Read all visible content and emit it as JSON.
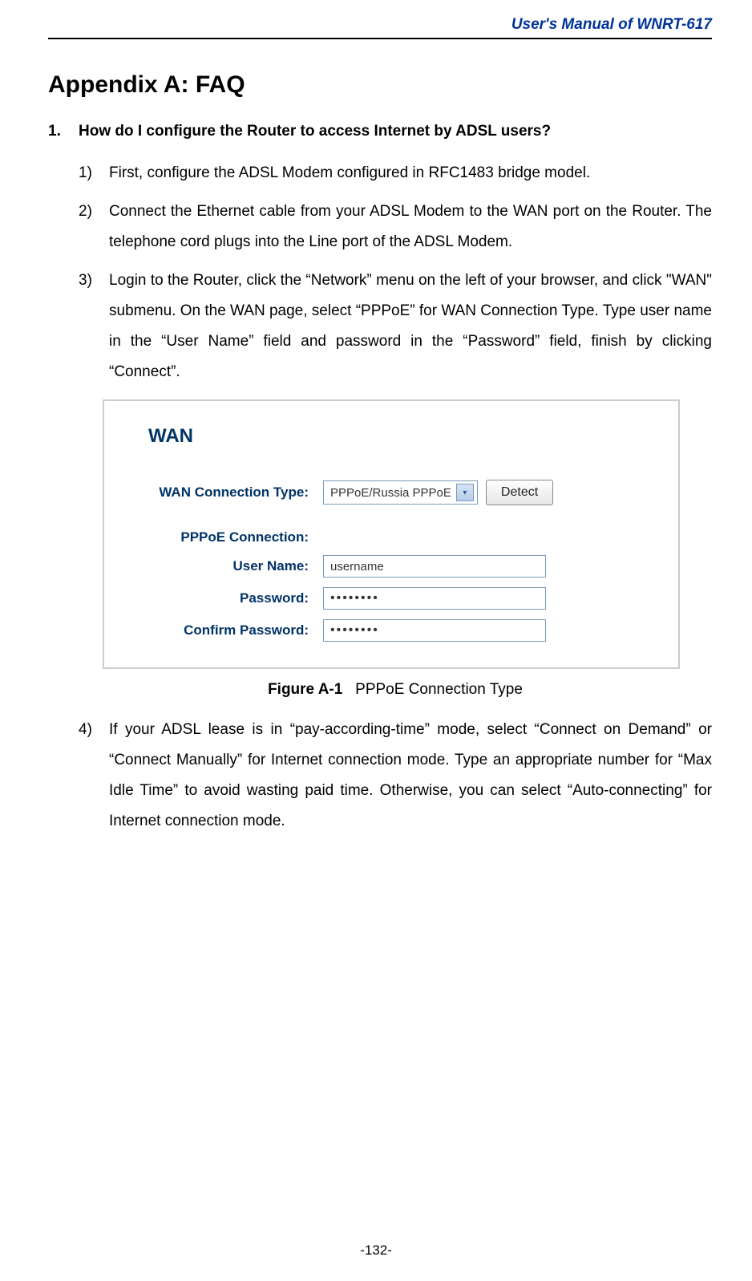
{
  "header": "User's Manual of WNRT-617",
  "h1": "Appendix A: FAQ",
  "question": {
    "num": "1.",
    "text": "How do I configure the Router to access Internet by ADSL users?"
  },
  "steps": [
    {
      "num": "1)",
      "text": "First, configure the ADSL Modem configured in RFC1483 bridge model."
    },
    {
      "num": "2)",
      "text": "Connect the Ethernet cable from your ADSL Modem to the WAN port on the Router. The telephone cord plugs into the Line port of the ADSL Modem."
    },
    {
      "num": "3)",
      "text": "Login to the Router, click the “Network” menu on the left of your browser, and click \"WAN\" submenu. On the WAN page, select “PPPoE” for WAN Connection Type. Type user name in the “User Name” field and password in the “Password” field, finish by clicking “Connect”."
    },
    {
      "num": "4)",
      "text": "If your ADSL lease is in “pay-according-time” mode, select “Connect on Demand” or “Connect Manually” for Internet connection mode. Type an appropriate number for “Max Idle Time” to avoid wasting paid time. Otherwise, you can select “Auto-connecting” for Internet connection mode."
    }
  ],
  "figure": {
    "heading": "WAN",
    "labels": {
      "wan_conn": "WAN Connection Type:",
      "pppoe_conn": "PPPoE Connection:",
      "username": "User Name:",
      "password": "Password:",
      "confirm": "Confirm Password:"
    },
    "values": {
      "wan_select": "PPPoE/Russia PPPoE",
      "detect_btn": "Detect",
      "username": "username",
      "password": "••••••••",
      "confirm": "••••••••"
    },
    "caption_bold": "Figure A-1",
    "caption_text": "   PPPoE Connection Type"
  },
  "footer": "-132-"
}
